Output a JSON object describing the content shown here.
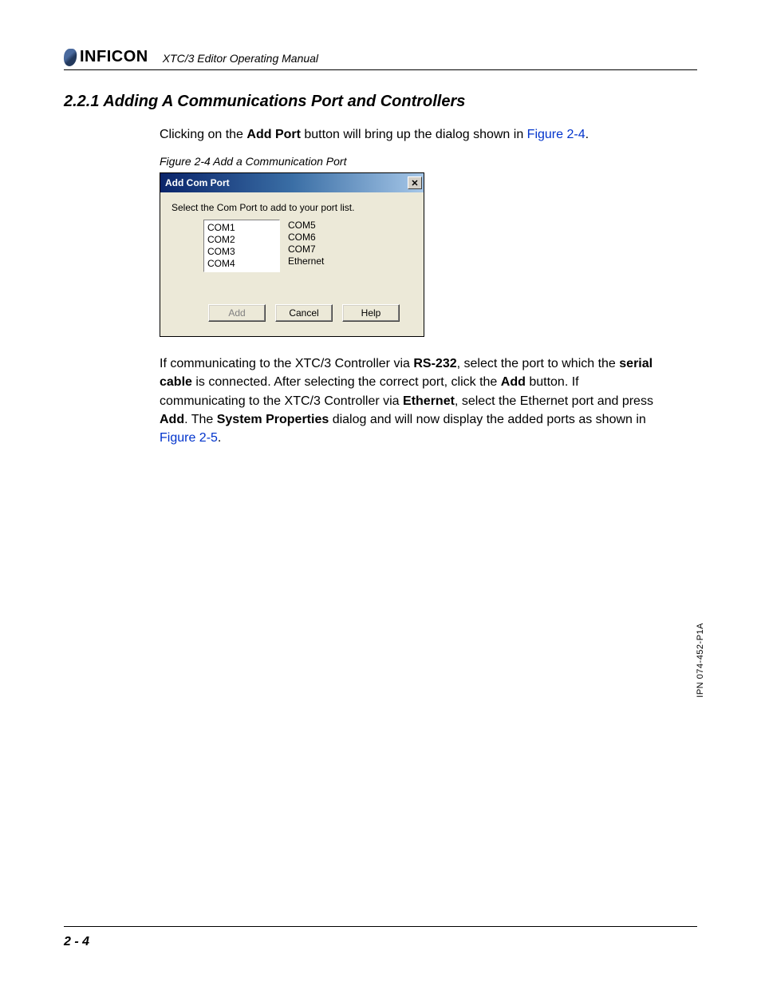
{
  "header": {
    "logo_text": "INFICON",
    "doc_title": "XTC/3 Editor Operating Manual"
  },
  "section": {
    "number": "2.2.1",
    "title": "Adding A Communications Port and Controllers"
  },
  "para1": {
    "t1": "Clicking on the ",
    "b1": "Add Port",
    "t2": " button will bring up the dialog shown in ",
    "link1": "Figure 2-4",
    "t3": "."
  },
  "figure_caption": "Figure 2-4  Add a Communication Port",
  "dialog": {
    "title": "Add Com Port",
    "close_glyph": "✕",
    "instruction": "Select the Com Port to add to your port list.",
    "ports_left": [
      "COM1",
      "COM2",
      "COM3",
      "COM4"
    ],
    "ports_right": [
      "COM5",
      "COM6",
      "COM7",
      "Ethernet"
    ],
    "buttons": {
      "add": "Add",
      "cancel": "Cancel",
      "help": "Help"
    }
  },
  "para2": {
    "t1": "If communicating to the XTC/3 Controller via ",
    "b1": "RS-232",
    "t2": ", select the port to which the ",
    "b2": "serial cable",
    "t3": " is connected. After selecting the correct port, click the ",
    "b3": "Add",
    "t4": " button. If communicating to the XTC/3 Controller via ",
    "b4": "Ethernet",
    "t5": ", select the Ethernet port and press ",
    "b5": "Add",
    "t6": ". The ",
    "b6": "System Properties",
    "t7": " dialog and will now display the added ports as shown in ",
    "link1": "Figure 2-5",
    "t8": "."
  },
  "side_code": "IPN 074-452-P1A",
  "page_number": "2 - 4"
}
